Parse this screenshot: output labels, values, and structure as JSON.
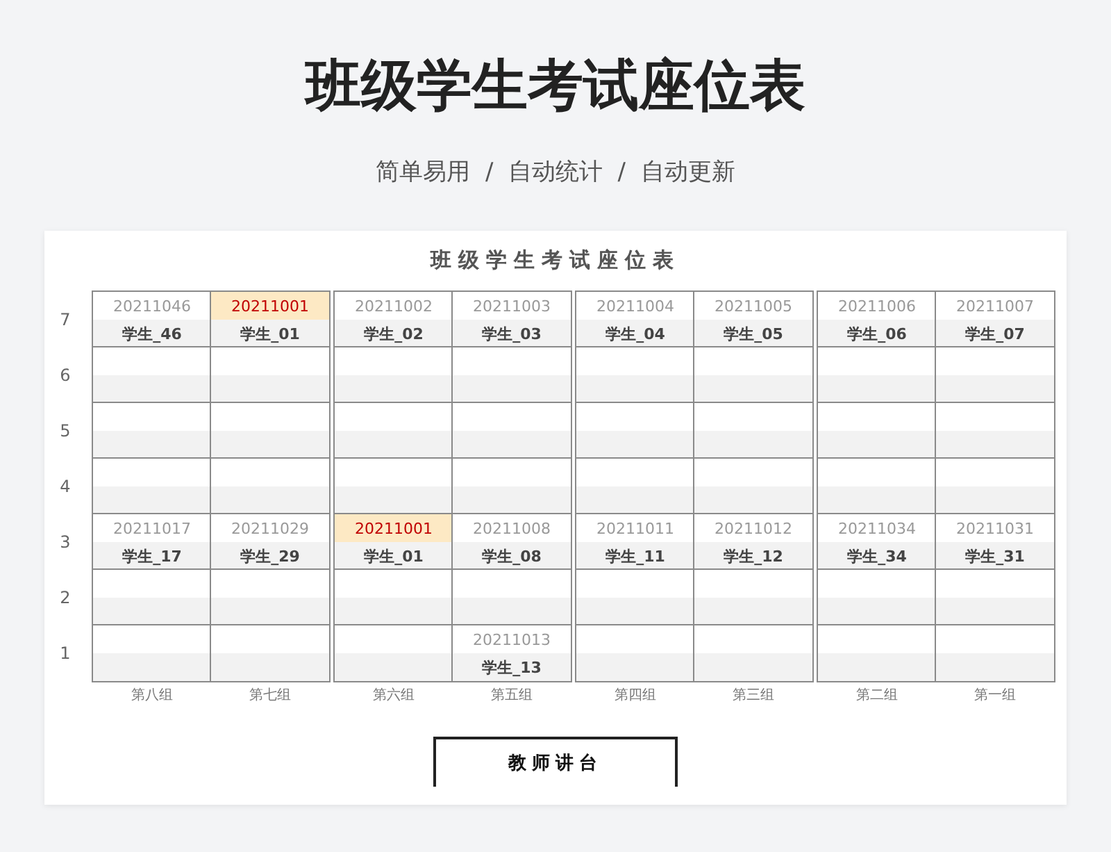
{
  "title": "班级学生考试座位表",
  "subtitle": "简单易用  /  自动统计  /  自动更新",
  "sheet_title": "班级学生考试座位表",
  "rows": [
    {
      "label": "7",
      "seats": [
        {
          "kind": "taken",
          "id": "20211046",
          "name": "学生_46",
          "highlighted": false
        },
        {
          "kind": "taken",
          "id": "20211001",
          "name": "学生_01",
          "highlighted": true
        },
        {
          "kind": "taken",
          "id": "20211002",
          "name": "学生_02",
          "highlighted": false
        },
        {
          "kind": "taken",
          "id": "20211003",
          "name": "学生_03",
          "highlighted": false
        },
        {
          "kind": "taken",
          "id": "20211004",
          "name": "学生_04",
          "highlighted": false
        },
        {
          "kind": "taken",
          "id": "20211005",
          "name": "学生_05",
          "highlighted": false
        },
        {
          "kind": "taken",
          "id": "20211006",
          "name": "学生_06",
          "highlighted": false
        },
        {
          "kind": "taken",
          "id": "20211007",
          "name": "学生_07",
          "highlighted": false
        }
      ]
    },
    {
      "label": "6",
      "seats": [
        {
          "kind": "vacant"
        },
        {
          "kind": "vacant"
        },
        {
          "kind": "vacant"
        },
        {
          "kind": "vacant"
        },
        {
          "kind": "vacant"
        },
        {
          "kind": "vacant"
        },
        {
          "kind": "vacant"
        },
        {
          "kind": "vacant"
        }
      ]
    },
    {
      "label": "5",
      "seats": [
        {
          "kind": "vacant"
        },
        {
          "kind": "vacant"
        },
        {
          "kind": "vacant"
        },
        {
          "kind": "vacant"
        },
        {
          "kind": "vacant"
        },
        {
          "kind": "vacant"
        },
        {
          "kind": "vacant"
        },
        {
          "kind": "vacant"
        }
      ]
    },
    {
      "label": "4",
      "seats": [
        {
          "kind": "vacant"
        },
        {
          "kind": "vacant"
        },
        {
          "kind": "vacant"
        },
        {
          "kind": "vacant"
        },
        {
          "kind": "vacant"
        },
        {
          "kind": "vacant"
        },
        {
          "kind": "vacant"
        },
        {
          "kind": "vacant"
        }
      ]
    },
    {
      "label": "3",
      "seats": [
        {
          "kind": "taken",
          "id": "20211017",
          "name": "学生_17",
          "highlighted": false
        },
        {
          "kind": "taken",
          "id": "20211029",
          "name": "学生_29",
          "highlighted": false
        },
        {
          "kind": "taken",
          "id": "20211001",
          "name": "学生_01",
          "highlighted": true
        },
        {
          "kind": "taken",
          "id": "20211008",
          "name": "学生_08",
          "highlighted": false
        },
        {
          "kind": "taken",
          "id": "20211011",
          "name": "学生_11",
          "highlighted": false
        },
        {
          "kind": "taken",
          "id": "20211012",
          "name": "学生_12",
          "highlighted": false
        },
        {
          "kind": "taken",
          "id": "20211034",
          "name": "学生_34",
          "highlighted": false
        },
        {
          "kind": "taken",
          "id": "20211031",
          "name": "学生_31",
          "highlighted": false
        }
      ]
    },
    {
      "label": "2",
      "seats": [
        {
          "kind": "vacant"
        },
        {
          "kind": "vacant"
        },
        {
          "kind": "vacant"
        },
        {
          "kind": "vacant"
        },
        {
          "kind": "vacant"
        },
        {
          "kind": "vacant"
        },
        {
          "kind": "vacant"
        },
        {
          "kind": "vacant"
        }
      ]
    },
    {
      "label": "1",
      "seats": [
        {
          "kind": "vacant"
        },
        {
          "kind": "vacant"
        },
        {
          "kind": "vacant"
        },
        {
          "kind": "taken",
          "id": "20211013",
          "name": "学生_13",
          "highlighted": false
        },
        {
          "kind": "vacant"
        },
        {
          "kind": "vacant"
        },
        {
          "kind": "vacant"
        },
        {
          "kind": "vacant"
        }
      ]
    }
  ],
  "groups": [
    "第八组",
    "第七组",
    "第六组",
    "第五组",
    "第四组",
    "第三组",
    "第二组",
    "第一组"
  ],
  "podium": "教师讲台"
}
